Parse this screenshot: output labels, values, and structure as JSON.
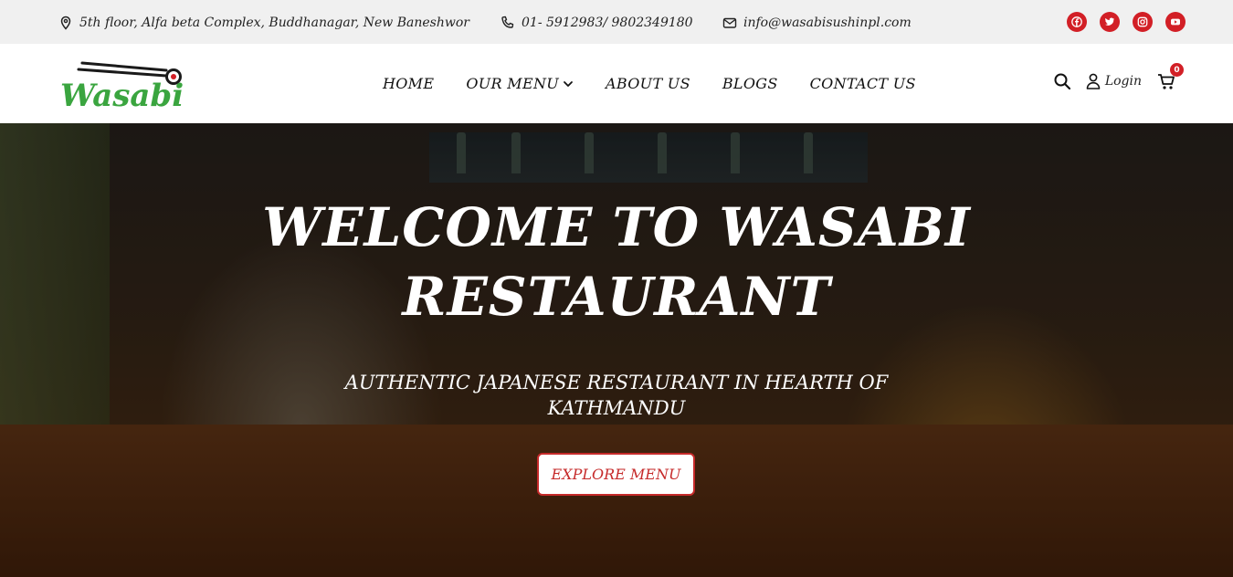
{
  "topbar": {
    "address": "5th floor, Alfa beta Complex, Buddhanagar, New Baneshwor",
    "phone": "01- 5912983/ 9802349180",
    "email": "info@wasabisushinpl.com",
    "social": [
      "facebook-icon",
      "twitter-icon",
      "instagram-icon",
      "youtube-icon"
    ]
  },
  "header": {
    "logo_text": "Wasabi",
    "nav": [
      {
        "label": "HOME"
      },
      {
        "label": "OUR MENU"
      },
      {
        "label": "ABOUT US"
      },
      {
        "label": "BLOGS"
      },
      {
        "label": "CONTACT US"
      }
    ],
    "login_label": "Login",
    "cart_count": "0"
  },
  "hero": {
    "title_line1": "WELCOME TO WASABI",
    "title_line2": "RESTAURANT",
    "subtitle_line1": "AUTHENTIC JAPANESE RESTAURANT IN HEARTH OF",
    "subtitle_line2": "KATHMANDU",
    "cta_label": "EXPLORE MENU"
  },
  "colors": {
    "accent": "#d21f26",
    "logo_green": "#3aa53f",
    "topbar_bg": "#f0f0f0"
  }
}
